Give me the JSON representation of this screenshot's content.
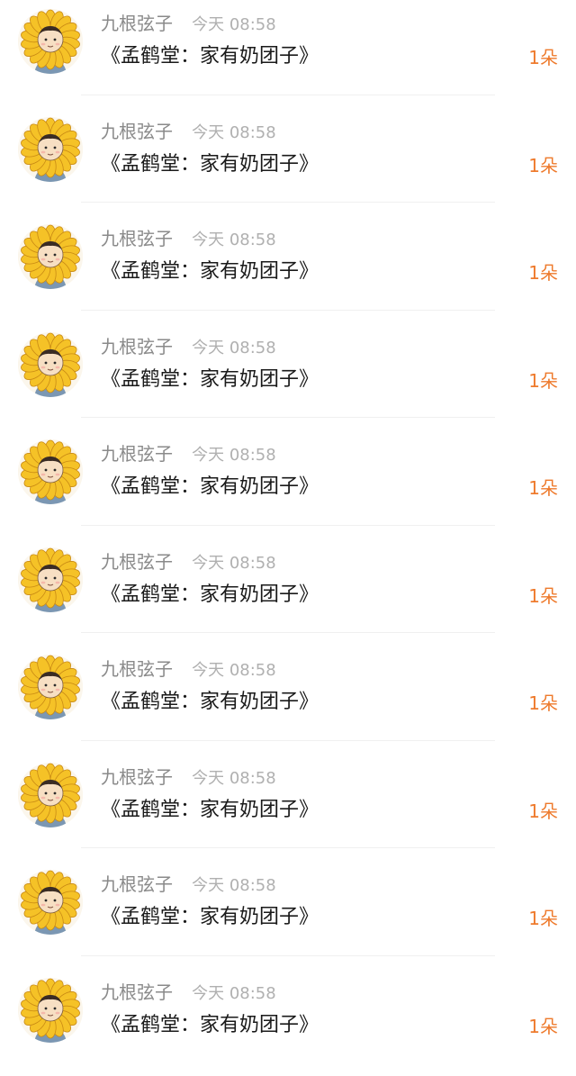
{
  "colors": {
    "count": "#ee7a2c",
    "name": "#8a8a8a",
    "time": "#b0b0b0",
    "title": "#1a1a1a",
    "petal": "#f5c227",
    "petal_outline": "#c98a14"
  },
  "items": [
    {
      "user": "九根弦子",
      "time": "今天 08:58",
      "title": "《孟鹤堂：家有奶团子》",
      "count": "1朵",
      "avatar_icon": "sunflower-avatar-icon"
    },
    {
      "user": "九根弦子",
      "time": "今天 08:58",
      "title": "《孟鹤堂：家有奶团子》",
      "count": "1朵",
      "avatar_icon": "sunflower-avatar-icon"
    },
    {
      "user": "九根弦子",
      "time": "今天 08:58",
      "title": "《孟鹤堂：家有奶团子》",
      "count": "1朵",
      "avatar_icon": "sunflower-avatar-icon"
    },
    {
      "user": "九根弦子",
      "time": "今天 08:58",
      "title": "《孟鹤堂：家有奶团子》",
      "count": "1朵",
      "avatar_icon": "sunflower-avatar-icon"
    },
    {
      "user": "九根弦子",
      "time": "今天 08:58",
      "title": "《孟鹤堂：家有奶团子》",
      "count": "1朵",
      "avatar_icon": "sunflower-avatar-icon"
    },
    {
      "user": "九根弦子",
      "time": "今天 08:58",
      "title": "《孟鹤堂：家有奶团子》",
      "count": "1朵",
      "avatar_icon": "sunflower-avatar-icon"
    },
    {
      "user": "九根弦子",
      "time": "今天 08:58",
      "title": "《孟鹤堂：家有奶团子》",
      "count": "1朵",
      "avatar_icon": "sunflower-avatar-icon"
    },
    {
      "user": "九根弦子",
      "time": "今天 08:58",
      "title": "《孟鹤堂：家有奶团子》",
      "count": "1朵",
      "avatar_icon": "sunflower-avatar-icon"
    },
    {
      "user": "九根弦子",
      "time": "今天 08:58",
      "title": "《孟鹤堂：家有奶团子》",
      "count": "1朵",
      "avatar_icon": "sunflower-avatar-icon"
    },
    {
      "user": "九根弦子",
      "time": "今天 08:58",
      "title": "《孟鹤堂：家有奶团子》",
      "count": "1朵",
      "avatar_icon": "sunflower-avatar-icon"
    }
  ]
}
